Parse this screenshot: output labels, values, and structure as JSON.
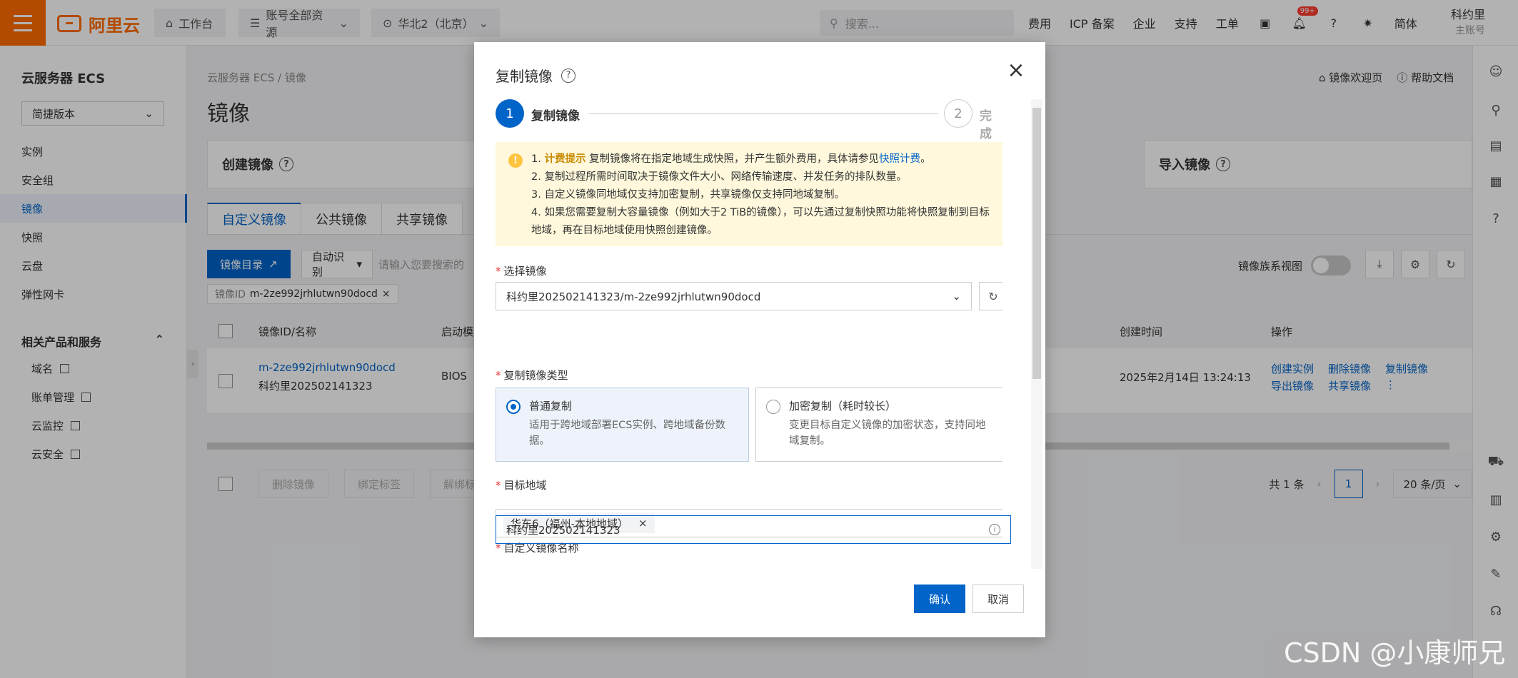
{
  "topbar": {
    "logo_text": "阿里云",
    "workbench": "工作台",
    "resources": "账号全部资源",
    "region": "华北2（北京）",
    "search_placeholder": "搜索...",
    "links": [
      "费用",
      "ICP 备案",
      "企业",
      "支持",
      "工单"
    ],
    "notif_badge": "99+",
    "lang": "简体",
    "user_name": "科约里",
    "user_role": "主账号"
  },
  "sidebar": {
    "title": "云服务器 ECS",
    "version_select": "简捷版本",
    "items": [
      "实例",
      "安全组",
      "镜像",
      "快照",
      "云盘",
      "弹性网卡"
    ],
    "related_title": "相关产品和服务",
    "related_items": [
      "域名",
      "账单管理",
      "云监控",
      "云安全"
    ]
  },
  "main": {
    "breadcrumb": "云服务器 ECS  /  镜像",
    "title": "镜像",
    "help_links": [
      "镜像欢迎页",
      "帮助文档"
    ],
    "cards": [
      "创建镜像",
      "导入镜像"
    ],
    "tabs": [
      "自定义镜像",
      "公共镜像",
      "共享镜像"
    ],
    "catalog_btn": "镜像目录",
    "auto_detect": "自动识别",
    "filter_placeholder": "请输入您要搜索的",
    "filter_tag_key": "镜像ID",
    "filter_tag_val": "m-2ze992jrhlutwn90docd",
    "family_view": "镜像族系视图",
    "columns": [
      "镜像ID/名称",
      "启动模式",
      "创建时间",
      "操作"
    ],
    "row": {
      "id": "m-2ze992jrhlutwn90docd",
      "name": "科约里202502141323",
      "boot": "BIOS",
      "created": "2025年2月14日 13:24:13",
      "actions1": [
        "创建实例",
        "删除镜像",
        "复制镜像"
      ],
      "actions2": [
        "导出镜像",
        "共享镜像"
      ]
    },
    "bottom_btns": [
      "删除镜像",
      "绑定标签",
      "解绑标签"
    ],
    "total": "共 1 条",
    "page": "1",
    "page_size": "20 条/页"
  },
  "modal": {
    "title": "复制镜像",
    "step1": "复制镜像",
    "step2": "完成",
    "notice_lines": [
      {
        "prefix": "1. ",
        "em": "计费提示",
        "text": " 复制镜像将在指定地域生成快照，并产生额外费用，具体请参见",
        "link": "快照计费",
        "suffix": "。"
      },
      {
        "text": "2. 复制过程所需时间取决于镜像文件大小、网络传输速度、并发任务的排队数量。"
      },
      {
        "text": "3. 自定义镜像同地域仅支持加密复制，共享镜像仅支持同地域复制。"
      },
      {
        "text": "4. 如果您需要复制大容量镜像（例如大于2 TiB的镜像），可以先通过复制快照功能将快照复制到目标地域，再在目标地域使用快照创建镜像。"
      }
    ],
    "select_image_label": "选择镜像",
    "select_image_value": "科约里202502141323/m-2ze992jrhlutwn90docd",
    "copy_type_label": "复制镜像类型",
    "copy_normal": "普通复制",
    "copy_normal_desc": "适用于跨地域部署ECS实例、跨地域备份数据。",
    "copy_encrypted": "加密复制（耗时较长）",
    "copy_encrypted_desc": "变更目标自定义镜像的加密状态，支持同地域复制。",
    "target_region_label": "目标地域",
    "target_region_tag": "华东6（福州-本地地域）",
    "custom_name_label": "自定义镜像名称",
    "custom_name_value": "科约里202502141323",
    "ok": "确认",
    "cancel": "取消"
  },
  "watermark": "CSDN @小康师兄",
  "colors": {
    "brand": "#ff6a00",
    "primary": "#0064c8",
    "notice_bg": "#fff8dc",
    "required": "#e62e2e"
  }
}
